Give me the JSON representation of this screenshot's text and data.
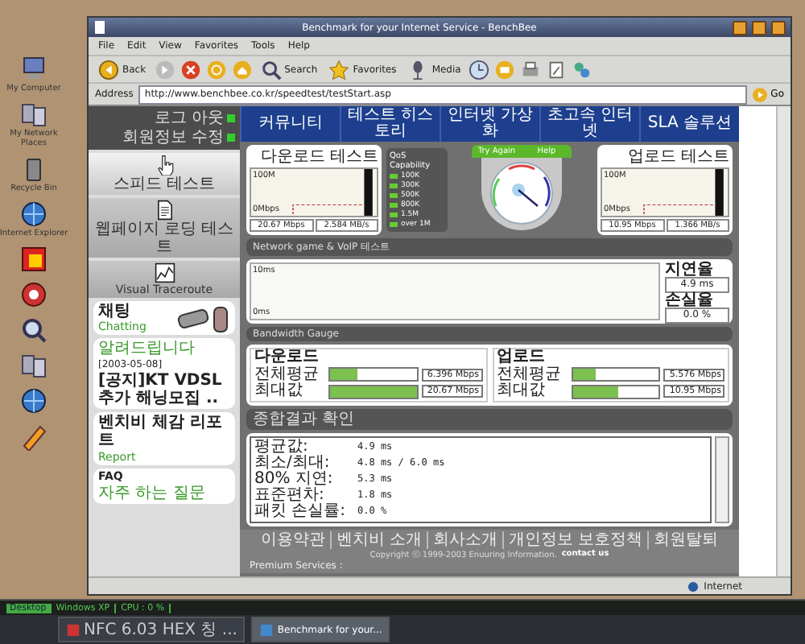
{
  "desktop": {
    "icons": [
      {
        "label": "My Computer",
        "kind": "computer"
      },
      {
        "label": "My Network Places",
        "kind": "network"
      },
      {
        "label": "Recycle Bin",
        "kind": "bin"
      },
      {
        "label": "Internet Explorer",
        "kind": "globe"
      },
      {
        "kind": "app"
      },
      {
        "kind": "media"
      },
      {
        "kind": "search"
      },
      {
        "kind": "network"
      },
      {
        "kind": "globe"
      },
      {
        "kind": "pen"
      }
    ]
  },
  "browser": {
    "title": "Benchmark for your Internet Service - BenchBee",
    "menu": [
      "File",
      "Edit",
      "View",
      "Favorites",
      "Tools",
      "Help"
    ],
    "toolbar": [
      {
        "label": "Back",
        "kind": "back"
      },
      {
        "label": "Search",
        "kind": "search"
      },
      {
        "label": "Favorites",
        "kind": "favorites"
      },
      {
        "label": "Media",
        "kind": "media"
      }
    ],
    "address_label": "Address",
    "url": "http://www.benchbee.co.kr/speedtest/testStart.asp",
    "go": "Go",
    "status": "Internet"
  },
  "page": {
    "login": [
      "로그 아웃",
      "회원정보 수정"
    ],
    "nav": [
      "커뮤니티",
      "테스트 히스토리",
      "인터넷 가상화",
      "초고속 인터넷",
      "SLA 솔루션"
    ],
    "side_menu": [
      {
        "label": "스피드 테스트",
        "kind": "speed",
        "selected": true
      },
      {
        "label": "웹페이지 로딩 테스트",
        "kind": "page",
        "selected": false
      },
      {
        "label": "Visual Traceroute",
        "kind": "trace",
        "selected": false
      }
    ],
    "chat": {
      "title": "채팅",
      "subtitle": "Chatting"
    },
    "notice": {
      "title": "알려드립니다",
      "date": "[2003-05-08]",
      "headline": "[공지]KT VDSL 추가 해닝모집 .."
    },
    "report": {
      "title": "벤치비 체감 리포트",
      "subtitle": "Report"
    },
    "faq": {
      "title": "FAQ",
      "subtitle": "자주 하는 질문"
    },
    "download": {
      "title": "다운로드 테스트",
      "y_top": "100M",
      "y_bottom": "0Mbps",
      "readings": [
        "20.67 Mbps",
        "2.584 MB/s"
      ]
    },
    "qos": {
      "title": "QoS Capability",
      "levels": [
        "100K",
        "300K",
        "500K",
        "800K",
        "1.5M",
        "over 1M"
      ]
    },
    "gauge": {
      "buttons": [
        "Try Again",
        "Help"
      ]
    },
    "upload": {
      "title": "업로드 테스트",
      "y_top": "100M",
      "y_bottom": "0Mbps",
      "readings": [
        "10.95 Mbps",
        "1.366 MB/s"
      ]
    },
    "voip": {
      "title": "Network game & VoIP 테스트",
      "y_top": "10ms",
      "y_bottom": "0ms",
      "delay_label": "지연율",
      "delay": "4.9 ms",
      "loss_label": "손실율",
      "loss": "0.0 %"
    },
    "bandwidth": {
      "title": "Bandwidth Gauge",
      "groups": [
        {
          "title": "다운로드",
          "rows": [
            {
              "label": "전체평균",
              "level": 0.31,
              "value": "6.396 Mbps"
            },
            {
              "label": "최대값",
              "level": 1.0,
              "value": "20.67 Mbps"
            }
          ]
        },
        {
          "title": "업로드",
          "rows": [
            {
              "label": "전체평균",
              "level": 0.27,
              "value": "5.576 Mbps"
            },
            {
              "label": "최대값",
              "level": 0.53,
              "value": "10.95 Mbps"
            }
          ]
        }
      ]
    },
    "results": {
      "title": "종합결과 확인",
      "lines": [
        {
          "label": "평균값:",
          "value": "4.9 ms"
        },
        {
          "label": "최소/최대:",
          "value": "4.8 ms / 6.0 ms"
        },
        {
          "label": "80% 지연:",
          "value": "5.3 ms"
        },
        {
          "label": "표준편차:",
          "value": "1.8 ms"
        },
        {
          "label": "패킷 손실률:",
          "value": "0.0 %"
        }
      ]
    },
    "footer": {
      "links": [
        "이용약관",
        "벤치비 소개",
        "회사소개",
        "개인정보 보호정책",
        "회원탈퇴"
      ],
      "copyright": "Copyright ⓒ 1999-2003 Enuuring Information.",
      "contact": "contact us",
      "premium": "Premium Services :"
    }
  },
  "taskbar": {
    "monitor": [
      "Desktop",
      "Windows XP",
      "CPU : 0 %"
    ],
    "tasks": [
      {
        "label": "NFC 6.03 HEX 칭 ...",
        "selected": false
      },
      {
        "label": "Benchmark for your...",
        "selected": true
      }
    ]
  }
}
